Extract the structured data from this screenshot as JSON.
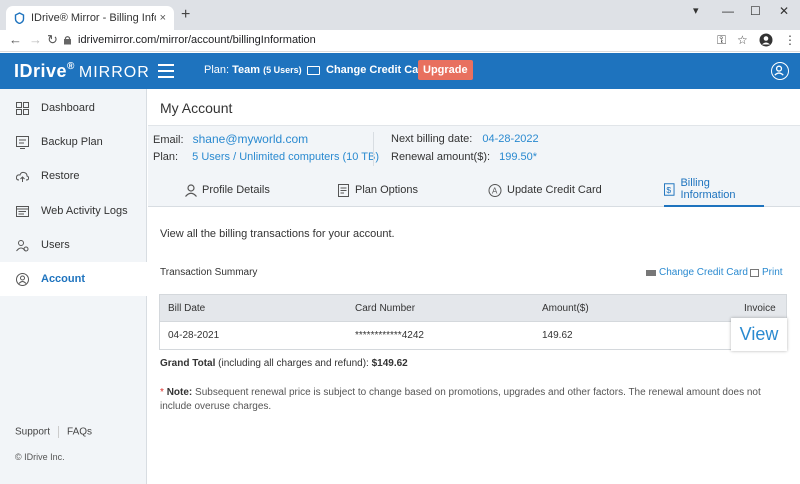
{
  "browser": {
    "tab_title": "IDrive® Mirror - Billing Information",
    "tab_close": "×",
    "new_tab": "+",
    "url": "idrivemirror.com/mirror/account/billingInformation",
    "win_min": "—",
    "win_max": "☐",
    "win_close": "✕",
    "nav_back": "←",
    "nav_fwd": "→",
    "nav_reload": "↻",
    "key_icon": "⚿",
    "star_icon": "☆",
    "menu_icon": "⋮",
    "dropdown_icon": "▾"
  },
  "header": {
    "logo_main": "IDrive",
    "logo_reg": "®",
    "logo_sub": "MIRROR",
    "plan_label": "Plan:",
    "plan_value": "Team",
    "plan_users": "(5 Users)",
    "change_cc": "Change Credit Card",
    "upgrade": "Upgrade",
    "accent": "#1e73be"
  },
  "sidebar": {
    "items": [
      {
        "label": "Dashboard",
        "icon": "dashboard-icon"
      },
      {
        "label": "Backup Plan",
        "icon": "backup-plan-icon"
      },
      {
        "label": "Restore",
        "icon": "restore-icon"
      },
      {
        "label": "Web Activity Logs",
        "icon": "web-activity-logs-icon"
      },
      {
        "label": "Users",
        "icon": "users-icon"
      },
      {
        "label": "Account",
        "icon": "account-icon"
      }
    ],
    "active_index": 5,
    "support": "Support",
    "faqs": "FAQs",
    "copyright": "© IDrive Inc."
  },
  "main": {
    "title": "My Account",
    "info": {
      "email_label": "Email:",
      "email_value": "shane@myworld.com",
      "plan_label": "Plan:",
      "plan_value": "5 Users / Unlimited computers (10 TB)",
      "next_billing_label": "Next billing date:",
      "next_billing_value": "04-28-2022",
      "renewal_label": "Renewal amount($):",
      "renewal_value": "199.50*"
    },
    "tabs": [
      {
        "label": "Profile Details",
        "icon": "profile-icon"
      },
      {
        "label": "Plan Options",
        "icon": "plan-options-icon"
      },
      {
        "label": "Update Credit Card",
        "icon": "update-credit-card-icon"
      },
      {
        "label": "Billing Information",
        "icon": "billing-information-icon"
      }
    ],
    "active_tab": 3,
    "intro": "View all the billing transactions for your account.",
    "summary_title": "Transaction Summary",
    "change_cc_link": "Change Credit Card",
    "print_link": "Print",
    "table": {
      "headers": [
        "Bill Date",
        "Card Number",
        "Amount($)",
        "Invoice"
      ],
      "rows": [
        {
          "bill_date": "04-28-2021",
          "card_number": "************4242",
          "amount": "149.62",
          "invoice": "View"
        }
      ]
    },
    "grand_total_label": "Grand Total",
    "grand_total_note": " (including all charges and refund): ",
    "grand_total_value": "$149.62",
    "note_star": "*",
    "note_label": "Note:",
    "note_text": " Subsequent renewal price is subject to change based on promotions, upgrades and other factors. The renewal amount does not include overuse charges."
  }
}
